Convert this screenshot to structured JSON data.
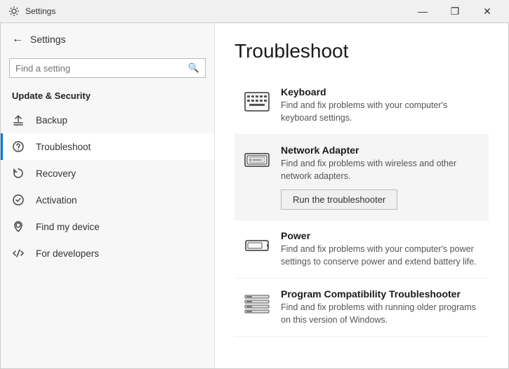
{
  "titlebar": {
    "title": "Settings",
    "minimize": "—",
    "maximize": "❐",
    "close": "✕"
  },
  "sidebar": {
    "back_label": "Settings",
    "search_placeholder": "Find a setting",
    "section_label": "Update & Security",
    "items": [
      {
        "id": "backup",
        "label": "Backup",
        "icon": "backup"
      },
      {
        "id": "troubleshoot",
        "label": "Troubleshoot",
        "icon": "troubleshoot",
        "active": true
      },
      {
        "id": "recovery",
        "label": "Recovery",
        "icon": "recovery"
      },
      {
        "id": "activation",
        "label": "Activation",
        "icon": "activation"
      },
      {
        "id": "find-my-device",
        "label": "Find my device",
        "icon": "find-device"
      },
      {
        "id": "for-developers",
        "label": "For developers",
        "icon": "developers"
      }
    ]
  },
  "content": {
    "title": "Troubleshoot",
    "items": [
      {
        "id": "keyboard",
        "title": "Keyboard",
        "desc": "Find and fix problems with your computer's keyboard settings.",
        "highlighted": false
      },
      {
        "id": "network-adapter",
        "title": "Network Adapter",
        "desc": "Find and fix problems with wireless and other network adapters.",
        "highlighted": true,
        "btn_label": "Run the troubleshooter"
      },
      {
        "id": "power",
        "title": "Power",
        "desc": "Find and fix problems with your computer's power settings to conserve power and extend battery life.",
        "highlighted": false
      },
      {
        "id": "program-compatibility",
        "title": "Program Compatibility Troubleshooter",
        "desc": "Find and fix problems with running older programs on this version of Windows.",
        "highlighted": false
      }
    ]
  }
}
